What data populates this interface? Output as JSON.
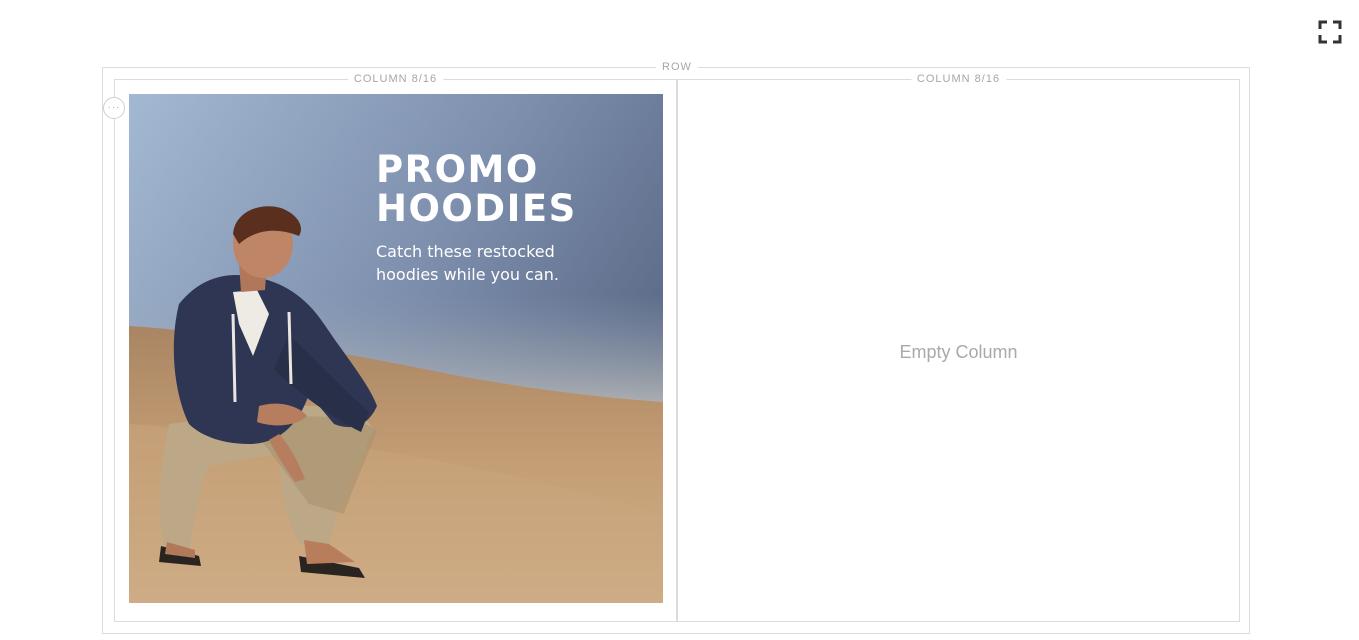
{
  "toolbar": {
    "fullscreen_icon": "fullscreen-icon"
  },
  "row": {
    "label": "ROW"
  },
  "columns": [
    {
      "label": "COLUMN 8/16",
      "options_icon": "more-options-icon",
      "banner": {
        "title_line1": "PROMO",
        "title_line2": "HOODIES",
        "subtitle_line1": "Catch these restocked",
        "subtitle_line2": "hoodies while you can."
      }
    },
    {
      "label": "COLUMN 8/16",
      "empty_text": "Empty Column"
    }
  ],
  "colors": {
    "border": "#dcdcdc",
    "label": "#a6a6a6",
    "sky_top": "#8fa6c4",
    "sand": "#b8936a",
    "hoodie": "#2e3550",
    "pants": "#bfa98a"
  }
}
